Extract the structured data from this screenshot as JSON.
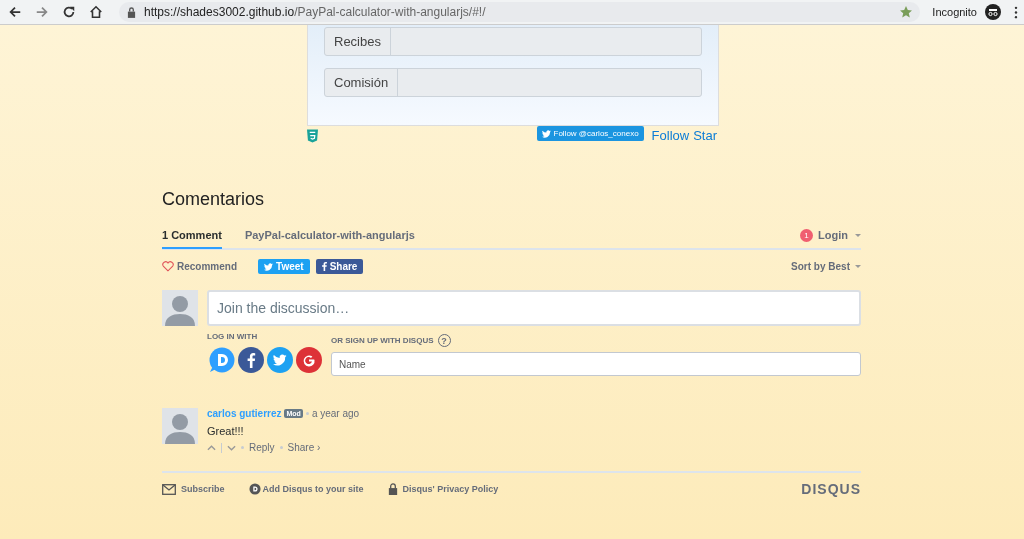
{
  "browser": {
    "url_host": "https://shades3002.github.io",
    "url_path": "/PayPal-calculator-with-angularjs/#!/",
    "bookmarked": true,
    "mode_label": "Incognito"
  },
  "calculator": {
    "rows": [
      {
        "label": "Recibes"
      },
      {
        "label": "Comisión"
      }
    ],
    "follow_button": "Follow @carlos_conexo",
    "links": [
      "Follow",
      "Star"
    ]
  },
  "comments": {
    "title": "Comentarios",
    "tabs": [
      {
        "label": "1 Comment",
        "selected": true
      },
      {
        "label": "PayPal-calculator-with-angularjs",
        "selected": false
      }
    ],
    "notification_count": "1",
    "login": "Login",
    "recommend": "Recommend",
    "tweet": "Tweet",
    "share": "Share",
    "sort": "Sort by Best",
    "composer": {
      "placeholder": "Join the discussion…",
      "login_label": "LOG IN WITH",
      "signup_label": "OR SIGN UP WITH DISQUS",
      "help": "?",
      "name_placeholder": "Name"
    },
    "list": [
      {
        "author": "carlos gutierrez",
        "badge": "Mod",
        "time": "a year ago",
        "text": "Great!!!",
        "reply": "Reply",
        "share": "Share ›"
      }
    ],
    "footer": {
      "subscribe": "Subscribe",
      "add": "Add Disqus to your site",
      "privacy": "Disqus' Privacy Policy",
      "logo": "DISQUS"
    }
  }
}
